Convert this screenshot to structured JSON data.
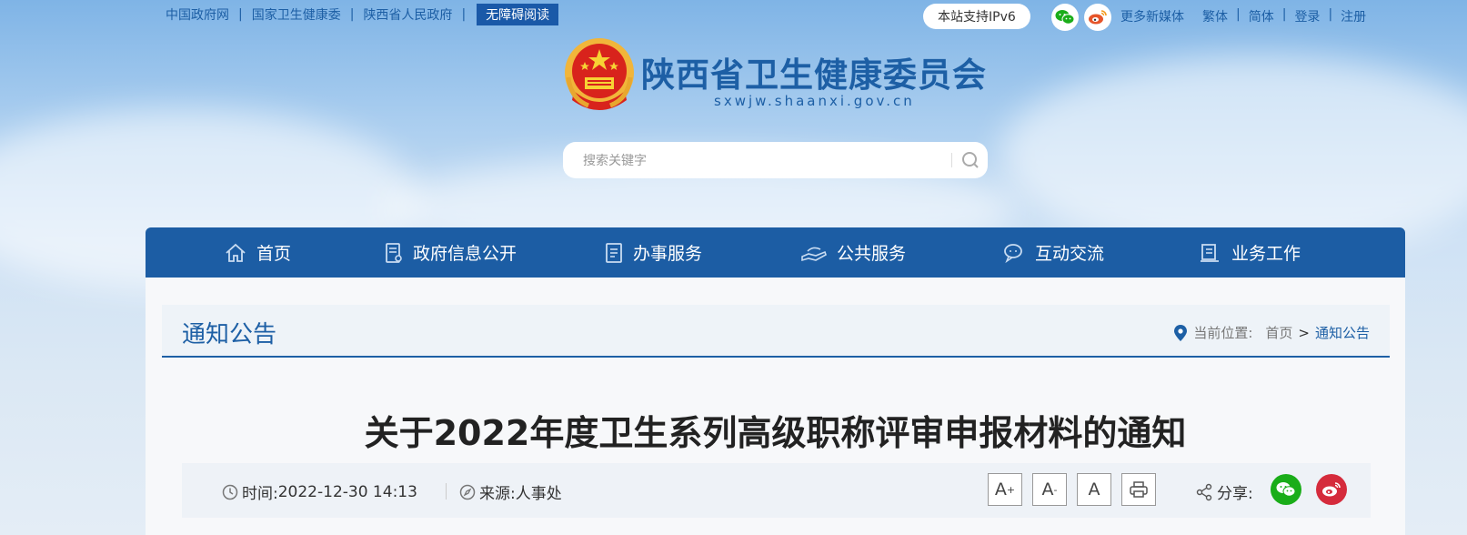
{
  "top_links": {
    "gov": "中国政府网",
    "nhc": "国家卫生健康委",
    "provgov": "陕西省人民政府",
    "accessible": "无障碍阅读",
    "sep": "|"
  },
  "ipv6": "本站支持IPv6",
  "right_links": {
    "media": "更多新媒体",
    "traditional": "繁体",
    "simplified": "简体",
    "login": "登录",
    "register": "注册",
    "sep": "|"
  },
  "site": {
    "title": "陕西省卫生健康委员会",
    "domain": "sxwjw.shaanxi.gov.cn"
  },
  "search": {
    "placeholder": "搜索关键字"
  },
  "nav": [
    {
      "label": "首页",
      "icon": "home-icon"
    },
    {
      "label": "政府信息公开",
      "icon": "document-icon"
    },
    {
      "label": "办事服务",
      "icon": "service-icon"
    },
    {
      "label": "公共服务",
      "icon": "hand-icon"
    },
    {
      "label": "互动交流",
      "icon": "chat-icon"
    },
    {
      "label": "业务工作",
      "icon": "book-icon"
    }
  ],
  "column": {
    "title": "通知公告",
    "breadcrumb_label": "当前位置:",
    "breadcrumb_home": "首页",
    "breadcrumb_sep": ">",
    "breadcrumb_current": "通知公告"
  },
  "article": {
    "title": "关于2022年度卫生系列高级职称评审申报材料的通知",
    "time_label": "时间:",
    "time_value": "2022-12-30 14:13",
    "source_label": "来源:",
    "source_value": "人事处",
    "font_large": "A",
    "font_large_sup": "+",
    "font_small": "A",
    "font_small_sup": "-",
    "font_default": "A",
    "share_label": "分享:"
  },
  "colors": {
    "brand_blue": "#1c5da4",
    "wechat_green": "#1aad19",
    "weibo_red": "#d52b3c"
  }
}
